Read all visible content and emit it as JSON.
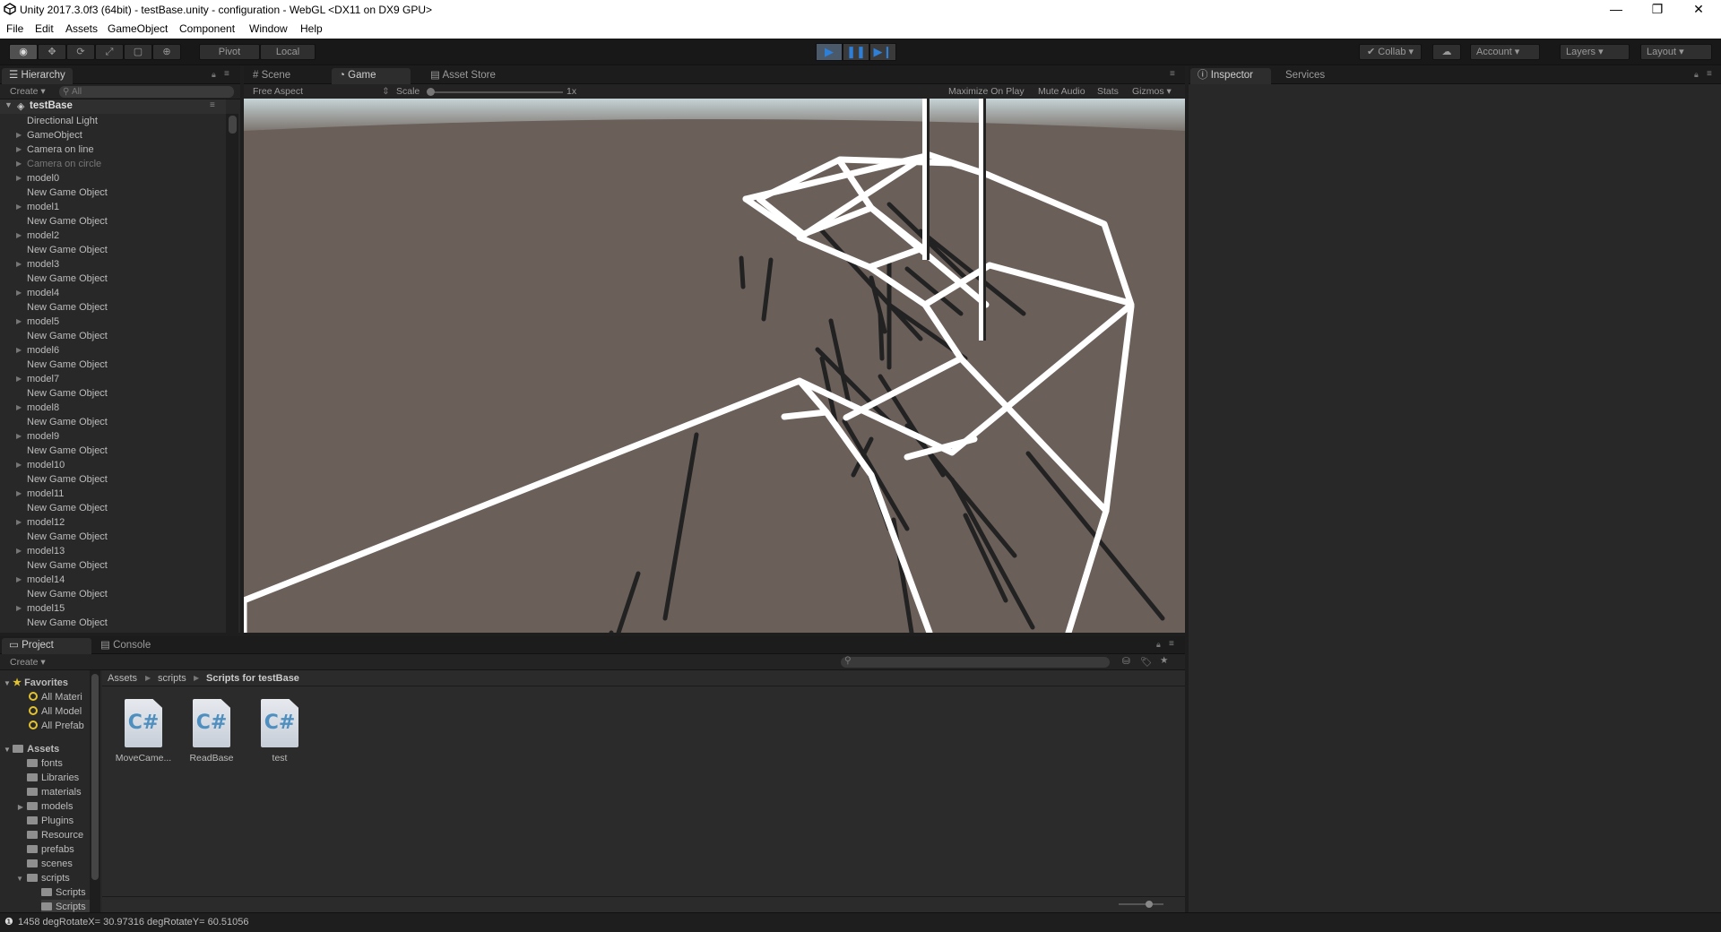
{
  "window": {
    "title": "Unity 2017.3.0f3 (64bit) - testBase.unity - configuration - WebGL <DX11 on DX9 GPU>",
    "minimize": "—",
    "maximize": "❐",
    "close": "✕"
  },
  "menu": [
    "File",
    "Edit",
    "Assets",
    "GameObject",
    "Component",
    "Window",
    "Help"
  ],
  "toolbar": {
    "pivot": "Pivot",
    "local": "Local",
    "collab": "Collab",
    "account": "Account",
    "layers": "Layers",
    "layout": "Layout"
  },
  "hierarchy": {
    "tab": "Hierarchy",
    "create": "Create",
    "search_placeholder": "All",
    "scene": "testBase",
    "items": [
      {
        "label": "Directional Light",
        "expand": false,
        "dim": false
      },
      {
        "label": "GameObject",
        "expand": true,
        "dim": false
      },
      {
        "label": "Camera on line",
        "expand": true,
        "dim": false
      },
      {
        "label": "Camera on circle",
        "expand": true,
        "dim": true
      },
      {
        "label": "model0",
        "expand": true,
        "dim": false
      },
      {
        "label": "New Game Object",
        "expand": false,
        "dim": false
      },
      {
        "label": "model1",
        "expand": true,
        "dim": false
      },
      {
        "label": "New Game Object",
        "expand": false,
        "dim": false
      },
      {
        "label": "model2",
        "expand": true,
        "dim": false
      },
      {
        "label": "New Game Object",
        "expand": false,
        "dim": false
      },
      {
        "label": "model3",
        "expand": true,
        "dim": false
      },
      {
        "label": "New Game Object",
        "expand": false,
        "dim": false
      },
      {
        "label": "model4",
        "expand": true,
        "dim": false
      },
      {
        "label": "New Game Object",
        "expand": false,
        "dim": false
      },
      {
        "label": "model5",
        "expand": true,
        "dim": false
      },
      {
        "label": "New Game Object",
        "expand": false,
        "dim": false
      },
      {
        "label": "model6",
        "expand": true,
        "dim": false
      },
      {
        "label": "New Game Object",
        "expand": false,
        "dim": false
      },
      {
        "label": "model7",
        "expand": true,
        "dim": false
      },
      {
        "label": "New Game Object",
        "expand": false,
        "dim": false
      },
      {
        "label": "model8",
        "expand": true,
        "dim": false
      },
      {
        "label": "New Game Object",
        "expand": false,
        "dim": false
      },
      {
        "label": "model9",
        "expand": true,
        "dim": false
      },
      {
        "label": "New Game Object",
        "expand": false,
        "dim": false
      },
      {
        "label": "model10",
        "expand": true,
        "dim": false
      },
      {
        "label": "New Game Object",
        "expand": false,
        "dim": false
      },
      {
        "label": "model11",
        "expand": true,
        "dim": false
      },
      {
        "label": "New Game Object",
        "expand": false,
        "dim": false
      },
      {
        "label": "model12",
        "expand": true,
        "dim": false
      },
      {
        "label": "New Game Object",
        "expand": false,
        "dim": false
      },
      {
        "label": "model13",
        "expand": true,
        "dim": false
      },
      {
        "label": "New Game Object",
        "expand": false,
        "dim": false
      },
      {
        "label": "model14",
        "expand": true,
        "dim": false
      },
      {
        "label": "New Game Object",
        "expand": false,
        "dim": false
      },
      {
        "label": "model15",
        "expand": true,
        "dim": false
      },
      {
        "label": "New Game Object",
        "expand": false,
        "dim": false
      }
    ]
  },
  "game": {
    "tabs": [
      "Scene",
      "Game",
      "Asset Store"
    ],
    "aspect": "Free Aspect",
    "scale_label": "Scale",
    "scale_value": "1x",
    "options": [
      "Maximize On Play",
      "Mute Audio",
      "Stats",
      "Gizmos"
    ]
  },
  "inspector": {
    "tabs": [
      "Inspector",
      "Services"
    ]
  },
  "project": {
    "tabs": [
      "Project",
      "Console"
    ],
    "create": "Create",
    "breadcrumb": [
      "Assets",
      "scripts",
      "Scripts for testBase"
    ],
    "favorites_label": "Favorites",
    "favorites": [
      "All Materi",
      "All Model",
      "All Prefab"
    ],
    "assets_label": "Assets",
    "folders": [
      {
        "label": "fonts",
        "expand": false
      },
      {
        "label": "Libraries",
        "expand": false
      },
      {
        "label": "materials",
        "expand": false
      },
      {
        "label": "models",
        "expand": true
      },
      {
        "label": "Plugins",
        "expand": false
      },
      {
        "label": "Resource",
        "expand": false
      },
      {
        "label": "prefabs",
        "expand": false
      },
      {
        "label": "scenes",
        "expand": false
      },
      {
        "label": "scripts",
        "expand": true
      }
    ],
    "subfolders": [
      "Scripts",
      "Scripts"
    ],
    "files": [
      {
        "icon": "C#",
        "label": "MoveCame..."
      },
      {
        "icon": "C#",
        "label": "ReadBase"
      },
      {
        "icon": "C#",
        "label": "test"
      }
    ]
  },
  "status": {
    "text": "1458 degRotateX= 30.97316 degRotateY= 60.51056"
  },
  "colors": {
    "accent": "#2d7fd8",
    "sky": "#d6e0e2",
    "ground": "#6a5f59"
  }
}
